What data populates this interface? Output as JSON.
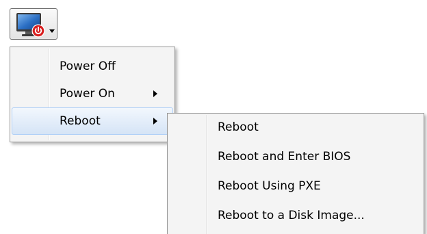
{
  "toolbar": {
    "power_button": {
      "icon": "monitor-power-icon",
      "has_dropdown": true
    }
  },
  "power_menu": {
    "items": [
      {
        "label": "Power Off",
        "has_submenu": false,
        "highlighted": false
      },
      {
        "label": "Power On",
        "has_submenu": true,
        "highlighted": false
      },
      {
        "label": "Reboot",
        "has_submenu": true,
        "highlighted": true
      }
    ]
  },
  "reboot_submenu": {
    "items": [
      {
        "label": "Reboot"
      },
      {
        "label": "Reboot and Enter BIOS"
      },
      {
        "label": "Reboot Using PXE"
      },
      {
        "label": "Reboot to a Disk Image..."
      }
    ]
  },
  "colors": {
    "menu_background": "#f4f4f4",
    "menu_border": "#979797",
    "highlight_border": "#aecff7",
    "monitor_blue": "#2b6fc4",
    "power_badge_red": "#d81f1f"
  }
}
